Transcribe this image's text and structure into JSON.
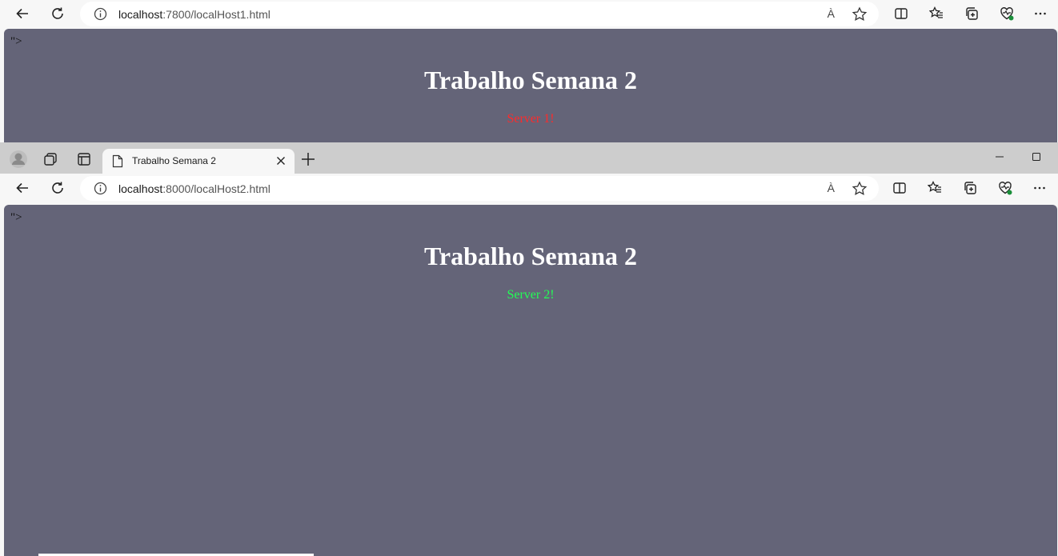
{
  "window1": {
    "url_host": "localhost",
    "url_path": ":7800/localHost1.html",
    "read_aloud": "À",
    "stray_text": "\">",
    "heading": "Trabalho Semana 2",
    "server_text": "Server 1!"
  },
  "window2": {
    "tab_title": "Trabalho Semana 2",
    "url_host": "localhost",
    "url_path": ":8000/localHost2.html",
    "read_aloud": "À",
    "stray_text": "\">",
    "heading": "Trabalho Semana 2",
    "server_text": "Server 2!"
  },
  "colors": {
    "page_bg": "#646478",
    "server1": "#ff2a2a",
    "server2": "#22ff55",
    "chrome": "#f7f7f7",
    "tabstrip": "#cdcdcd"
  },
  "icons": [
    "back-icon",
    "refresh-icon",
    "info-icon",
    "read-aloud-icon",
    "favorite-star-icon",
    "split-screen-icon",
    "favorites-icon",
    "collections-icon",
    "browser-essentials-icon",
    "more-icon",
    "profile-icon",
    "workspaces-icon",
    "tab-actions-icon",
    "page-icon",
    "close-icon",
    "new-tab-icon",
    "minimize-icon",
    "maximize-icon"
  ]
}
